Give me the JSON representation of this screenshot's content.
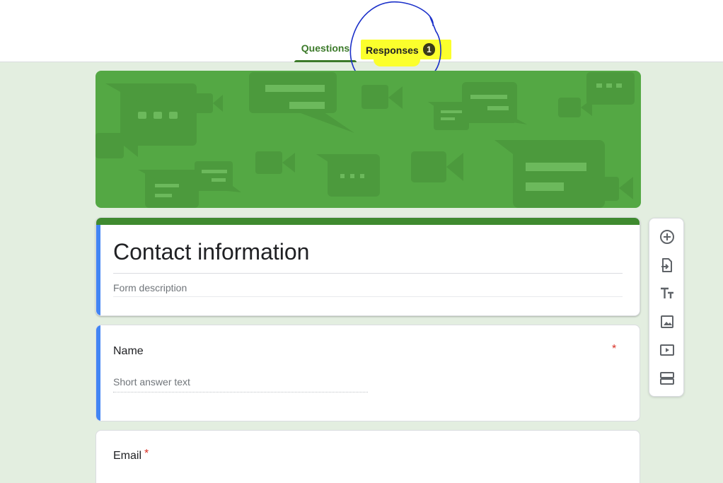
{
  "tabs": {
    "questions": "Questions",
    "responses": "Responses",
    "responses_count": "1"
  },
  "form": {
    "title": "Contact information",
    "description_placeholder": "Form description"
  },
  "questions": [
    {
      "title": "Name",
      "required_mark": "*",
      "answer_placeholder": "Short answer text"
    },
    {
      "title": "Email",
      "required_mark": "*"
    }
  ],
  "toolbar": {
    "items": [
      "add-question-icon",
      "import-questions-icon",
      "add-title-icon",
      "add-image-icon",
      "add-video-icon",
      "add-section-icon"
    ]
  },
  "colors": {
    "accent": "#3c7a2a",
    "banner": "#54a844",
    "highlight": "#fbff2c",
    "annotation": "#1a2fc9",
    "required": "#d93025",
    "selected_stripe": "#4285f4"
  }
}
